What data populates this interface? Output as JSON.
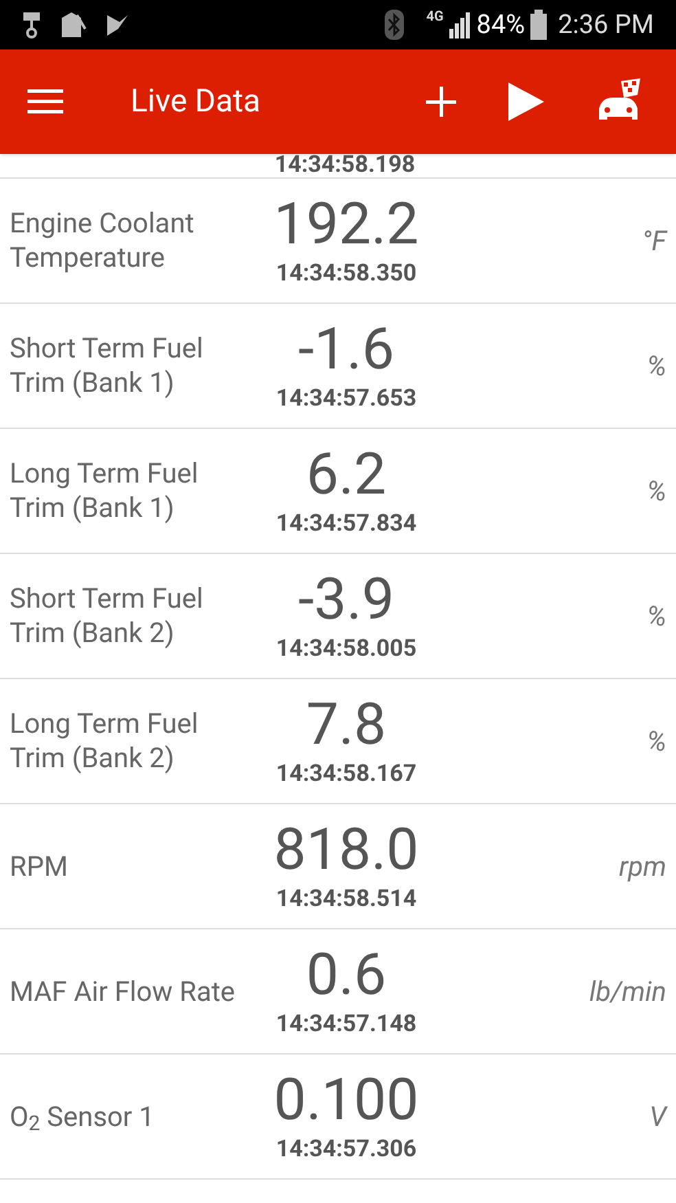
{
  "status_bar": {
    "network": "4G",
    "battery": "84%",
    "time": "2:36 PM"
  },
  "app_bar": {
    "title": "Live Data"
  },
  "partial_top": {
    "timestamp": "14:34:58.198"
  },
  "readings": [
    {
      "label": "Engine Coolant Temperature",
      "value": "192.2",
      "timestamp": "14:34:58.350",
      "unit": "°F"
    },
    {
      "label": "Short Term Fuel Trim (Bank 1)",
      "value": "-1.6",
      "timestamp": "14:34:57.653",
      "unit": "%"
    },
    {
      "label": "Long Term Fuel Trim (Bank 1)",
      "value": "6.2",
      "timestamp": "14:34:57.834",
      "unit": "%"
    },
    {
      "label": "Short Term Fuel Trim (Bank 2)",
      "value": "-3.9",
      "timestamp": "14:34:58.005",
      "unit": "%"
    },
    {
      "label": "Long Term Fuel Trim (Bank 2)",
      "value": "7.8",
      "timestamp": "14:34:58.167",
      "unit": "%"
    },
    {
      "label": "RPM",
      "value": "818.0",
      "timestamp": "14:34:58.514",
      "unit": "rpm"
    },
    {
      "label": "MAF Air Flow Rate",
      "value": "0.6",
      "timestamp": "14:34:57.148",
      "unit": "lb/min"
    },
    {
      "label": "O$_{2}$ Sensor 1",
      "value": "0.100",
      "timestamp": "14:34:57.306",
      "unit": "V"
    }
  ]
}
